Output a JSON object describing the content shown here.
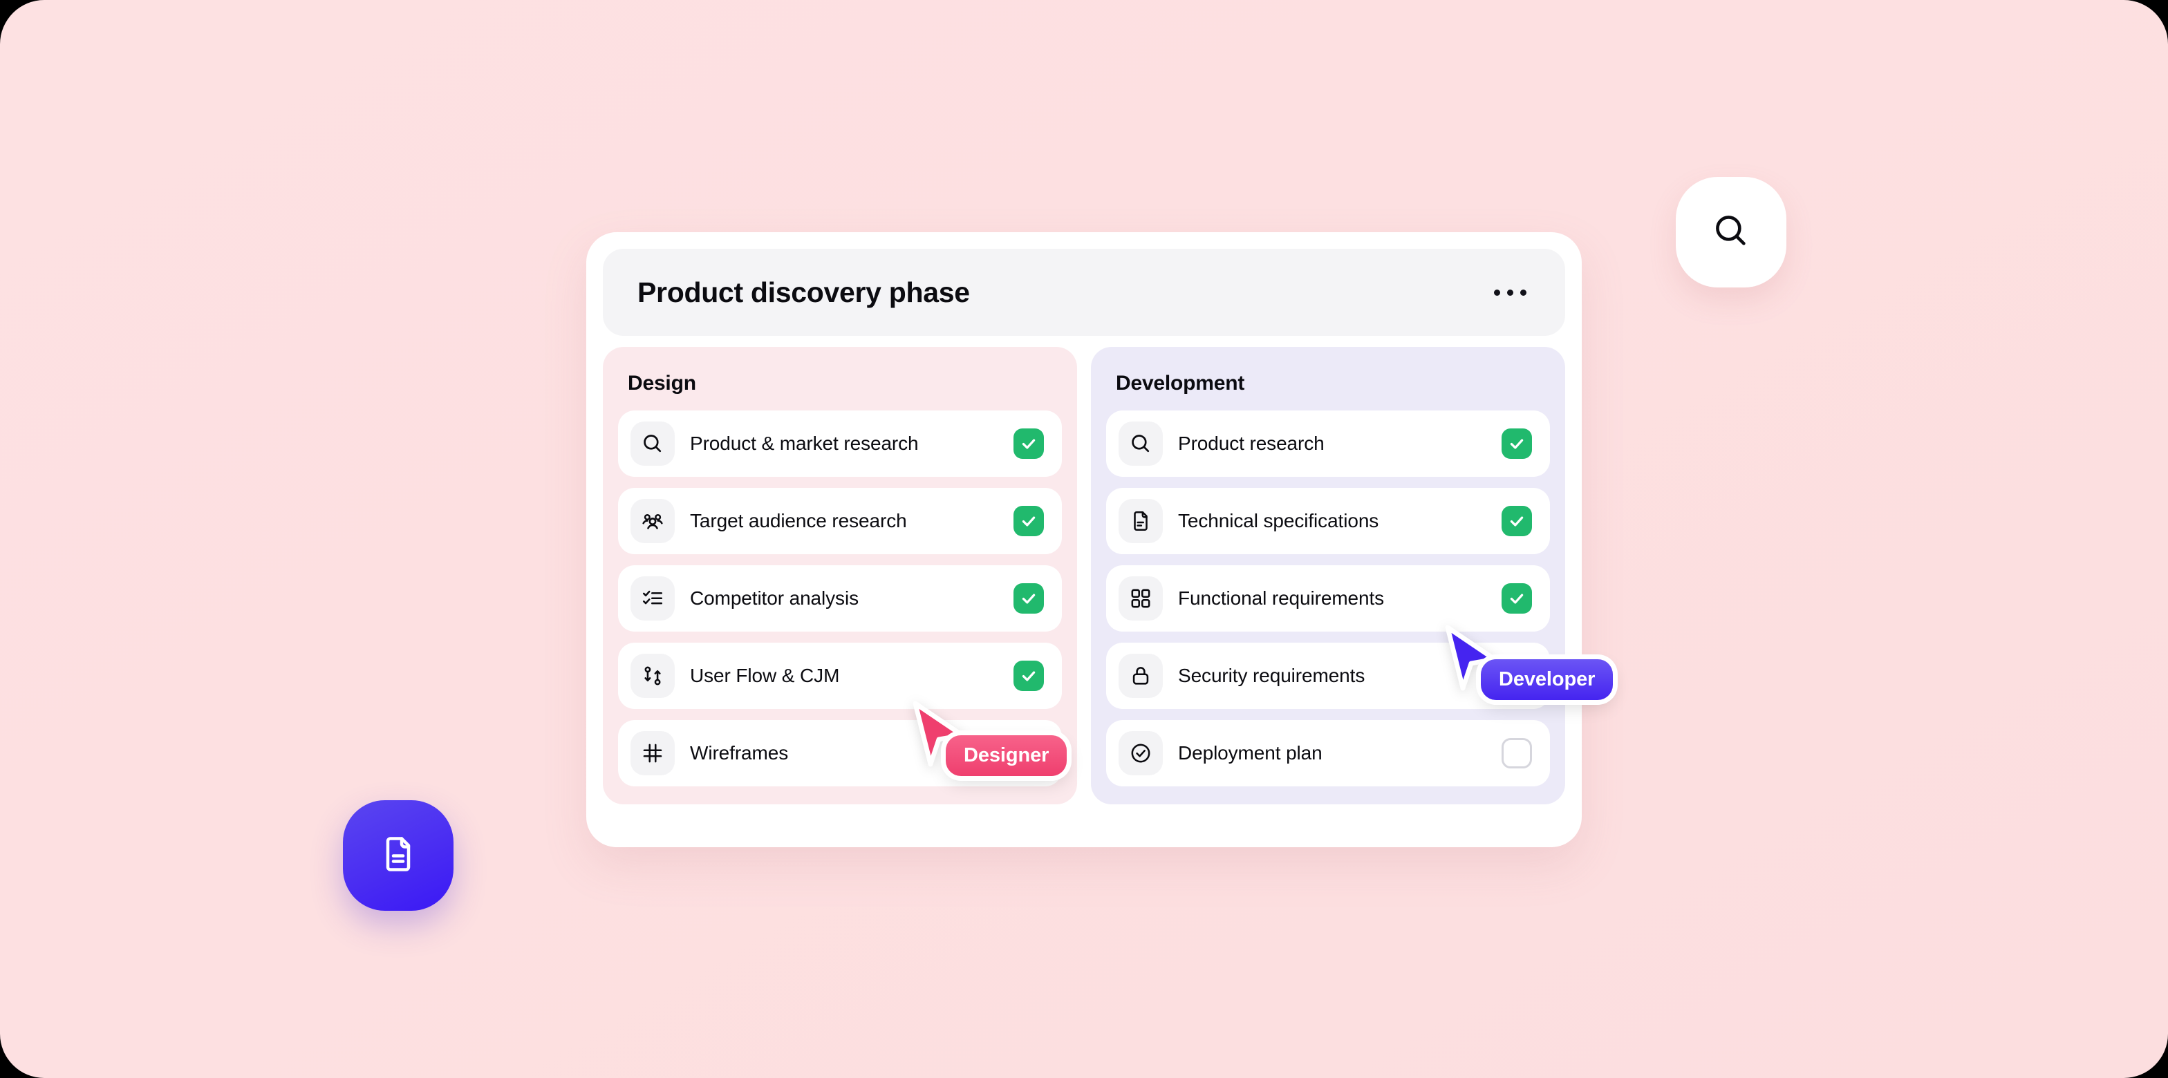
{
  "board": {
    "title": "Product discovery phase",
    "more_menu_label": "•••"
  },
  "columns": [
    {
      "id": "design",
      "title": "Design",
      "accent": "#fbe9ec",
      "tasks": [
        {
          "label": "Product & market research",
          "icon": "search-icon",
          "checked": true
        },
        {
          "label": "Target audience research",
          "icon": "users-icon",
          "checked": true
        },
        {
          "label": "Competitor analysis",
          "icon": "checklist-icon",
          "checked": true
        },
        {
          "label": "User Flow & CJM",
          "icon": "git-branch-icon",
          "checked": true
        },
        {
          "label": "Wireframes",
          "icon": "hash-grid-icon",
          "checked": false
        }
      ]
    },
    {
      "id": "development",
      "title": "Development",
      "accent": "#eceaf8",
      "tasks": [
        {
          "label": "Product research",
          "icon": "search-icon",
          "checked": true
        },
        {
          "label": "Technical specifications",
          "icon": "document-icon",
          "checked": true
        },
        {
          "label": "Functional requirements",
          "icon": "grid-squares-icon",
          "checked": true
        },
        {
          "label": "Security requirements",
          "icon": "lock-icon",
          "checked": false
        },
        {
          "label": "Deployment plan",
          "icon": "check-circle-icon",
          "checked": false
        }
      ]
    }
  ],
  "cursors": [
    {
      "id": "designer",
      "label": "Designer",
      "color": "#ef3f6e"
    },
    {
      "id": "developer",
      "label": "Developer",
      "color": "#4524f0"
    }
  ],
  "floating_chips": [
    {
      "id": "search-chip",
      "icon": "search-icon",
      "background": "#ffffff"
    },
    {
      "id": "doc-chip",
      "icon": "document-icon",
      "background": "#4a2df2"
    }
  ],
  "colors": {
    "page_background": "#fde1e2",
    "card_background": "#ffffff",
    "checked_green": "#21b96d",
    "designer_pink": "#ef3f6e",
    "developer_indigo": "#4524f0"
  }
}
